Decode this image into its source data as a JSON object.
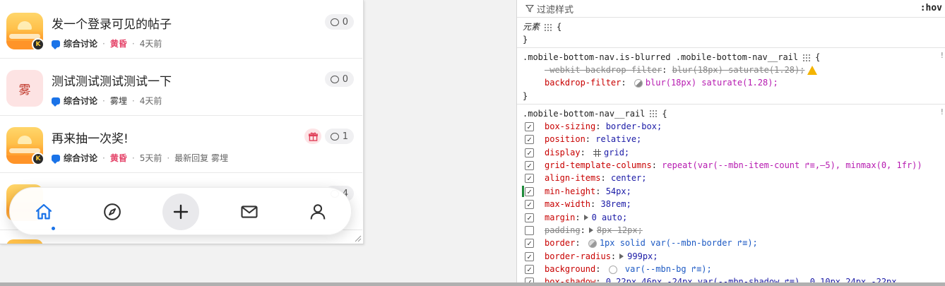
{
  "posts": [
    {
      "title": "发一个登录可见的帖子",
      "category": "综合讨论",
      "user": "黄昏",
      "time": "4天前",
      "replies": "0",
      "avatar": "sun"
    },
    {
      "title": "测试测试测试测试一下",
      "category": "综合讨论",
      "user": "雾埋",
      "time": "4天前",
      "replies": "0",
      "avatar": "fog",
      "avatar_text": "雾"
    },
    {
      "title": "再来抽一次奖!",
      "category": "综合讨论",
      "user": "黄昏",
      "time": "5天前",
      "replies": "1",
      "avatar": "sun",
      "last_reply": "最新回复 雾埋"
    }
  ],
  "hidden_post": {
    "replies": "4"
  },
  "nav": {
    "active": "home",
    "items": [
      "home",
      "explore",
      "add",
      "messages",
      "profile"
    ]
  },
  "colors": {
    "accent": "#1a73e8",
    "user_red": "#e5466b",
    "gift": "#e0405a"
  },
  "devtools": {
    "filter_placeholder": "过滤样式",
    "hov": ":hov",
    "element_label": "元素",
    "brace_open": "{",
    "brace_close": "}",
    "rule1_selector": ".mobile-bottom-nav.is-blurred .mobile-bottom-nav__rail",
    "rule1_decls": [
      {
        "prop": "-webkit-backdrop-filter",
        "val": "blur(18px) saturate(1.28);",
        "struck": true,
        "warn": true
      },
      {
        "prop": "backdrop-filter",
        "val": "blur(18px) saturate(1.28);",
        "struck": false
      }
    ],
    "rule2_selector": ".mobile-bottom-nav__rail",
    "rule2_decls": [
      {
        "prop": "box-sizing",
        "val": "border-box;"
      },
      {
        "prop": "position",
        "val": "relative;"
      },
      {
        "prop": "display",
        "val": "grid;"
      },
      {
        "prop": "grid-template-columns",
        "val": "repeat(var(--mbn-item-count ↱≡,—5), minmax(0, 1fr))"
      },
      {
        "prop": "align-items",
        "val": "center;"
      },
      {
        "prop": "min-height",
        "val": "54px;"
      },
      {
        "prop": "max-width",
        "val": "38rem;"
      },
      {
        "prop": "margin",
        "val": "0 auto;"
      },
      {
        "prop": "padding",
        "val": "8px 12px;",
        "struck": true
      },
      {
        "prop": "border",
        "val": "1px solid  var(--mbn-border ↱≡);"
      },
      {
        "prop": "border-radius",
        "val": "999px;"
      },
      {
        "prop": "background",
        "val": " var(--mbn-bg ↱≡);"
      },
      {
        "prop": "box-shadow",
        "val": "0 22px 46px -24px  var(--mbn-shadow ↱≡), 0 10px 24px -22px"
      }
    ]
  }
}
